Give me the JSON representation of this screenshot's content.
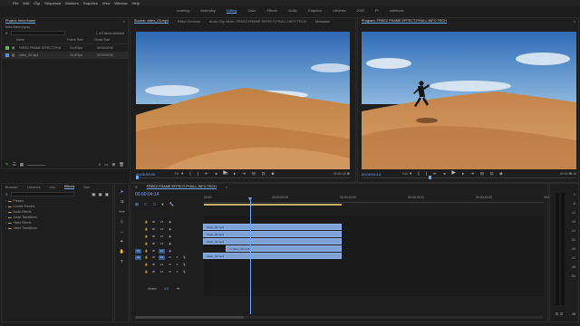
{
  "menubar": {
    "items": [
      "File",
      "Edit",
      "Clip",
      "Sequence",
      "Markers",
      "Graphics",
      "View",
      "Window",
      "Help"
    ]
  },
  "workspaces": {
    "items": [
      "Learning",
      "Assembly",
      "Editing",
      "Color",
      "Effects",
      "Audio",
      "Graphics",
      "Libraries",
      "2020",
      "Pr",
      "notebook"
    ],
    "active": "Editing"
  },
  "project": {
    "tab_label": "Project: freez frame",
    "file_name": "freez frame.prproj",
    "selection_info": "1 of 2 items selected",
    "columns": [
      "Name",
      "Frame Rate",
      "Media Start"
    ],
    "rows": [
      {
        "name": "FREEZ FRAME EFFECT-PHU",
        "rate": "24.00 fps",
        "start": "00:00:00:00",
        "color": "#6db35f"
      },
      {
        "name": "video_03.mp4",
        "rate": "24.00 fps",
        "start": "00:00:00:00",
        "color": "#5a8ed6"
      }
    ]
  },
  "source": {
    "tabs": [
      "Source: video_03.mp4",
      "Effect Controls",
      "Audio Clip Mixer: FREEZ FRAME EFFECT-PHULL INFO TECH",
      "Metadata"
    ],
    "timecode": "00:00:00:00",
    "fit": "Fit",
    "scale": "1/2",
    "duration": "00:00:13:18"
  },
  "program": {
    "tab_label": "Program: FREEZ FRAME EFFECT-PHULL INFO TECH",
    "timecode": "00:00:04:14",
    "fit": "Full",
    "duration": "00:00:13:18"
  },
  "effects_panel": {
    "tabs": [
      "Browser",
      "Libraries",
      "Info",
      "Effects",
      "Mar"
    ],
    "active_tab": "Effects",
    "folders": [
      "Presets",
      "Lumetri Presets",
      "Audio Effects",
      "Audio Transitions",
      "Video Effects",
      "Video Transitions"
    ]
  },
  "timeline": {
    "tab_label": "FREEZ FRAME EFFECT-PHULL INFO TECH",
    "timecode": "00:00:04:14",
    "ruler": [
      "00:00",
      "00:00:05:00",
      "00:00:10:00",
      "00:00:15:00",
      "00:00:20:00",
      "00:00:25:00"
    ],
    "video_tracks": [
      "V5",
      "V4",
      "V3",
      "V2",
      "V1"
    ],
    "audio_tracks": [
      "A1",
      "A2",
      "A3"
    ],
    "master_label": "Master",
    "master_value": "0.0",
    "clips": [
      {
        "track": "V4",
        "label": "video_03.mp4"
      },
      {
        "track": "V3",
        "label": "video_03.mp4"
      },
      {
        "track": "V2",
        "label": "video_03.mp4"
      },
      {
        "track": "V1",
        "label": "video_03.mp4"
      }
    ],
    "v1_marker": "fx"
  },
  "meter": {
    "scale": [
      "0",
      "-6",
      "-12",
      "-18",
      "-24",
      "-30",
      "-36",
      "-42",
      "-48",
      "-54"
    ],
    "db": "dB"
  },
  "icons": {
    "play": "play-icon",
    "step_back": "step-back-icon",
    "step_forward": "step-forward-icon",
    "marker": "marker-icon",
    "wrench": "wrench-icon"
  },
  "colors": {
    "accent": "#6fa7ff",
    "clip": "#7ea2d6",
    "sky_top": "#2f6cb5",
    "sand": "#c98a4d"
  }
}
